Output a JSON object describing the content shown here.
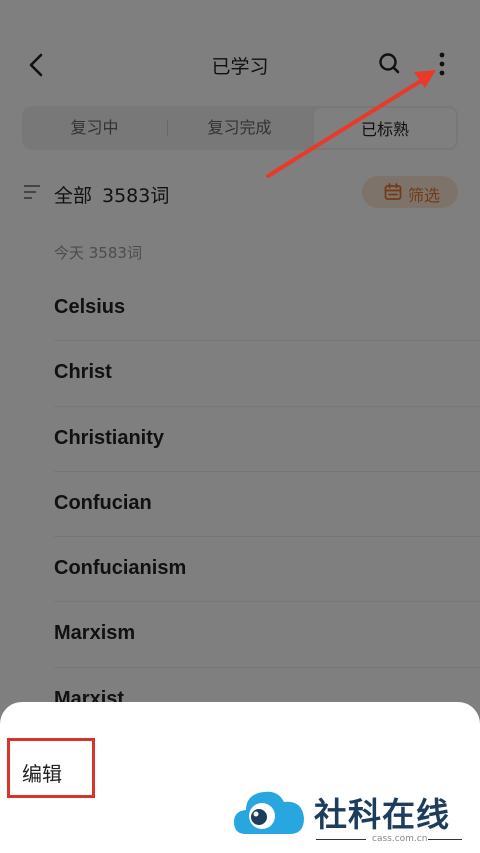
{
  "header": {
    "title": "已学习",
    "back_icon": "chevron-left-icon",
    "search_icon": "search-icon",
    "more_icon": "more-vertical-icon"
  },
  "tabs": [
    {
      "label": "复习中",
      "active": false
    },
    {
      "label": "复习完成",
      "active": false
    },
    {
      "label": "已标熟",
      "active": true
    }
  ],
  "summary": {
    "label": "全部",
    "count": "3583词",
    "filter_label": "筛选",
    "filter_icon": "calendar-icon",
    "accent_color": "#e5772f"
  },
  "group": {
    "heading": "今天  3583词"
  },
  "words": [
    "Celsius",
    "Christ",
    "Christianity",
    "Confucian",
    "Confucianism",
    "Marxism",
    "Marxist"
  ],
  "bottom_sheet": {
    "edit_label": "编辑"
  },
  "watermark": {
    "brand": "社科在线",
    "url": "cass.com.cn"
  },
  "annotation_color": "#d9342b"
}
